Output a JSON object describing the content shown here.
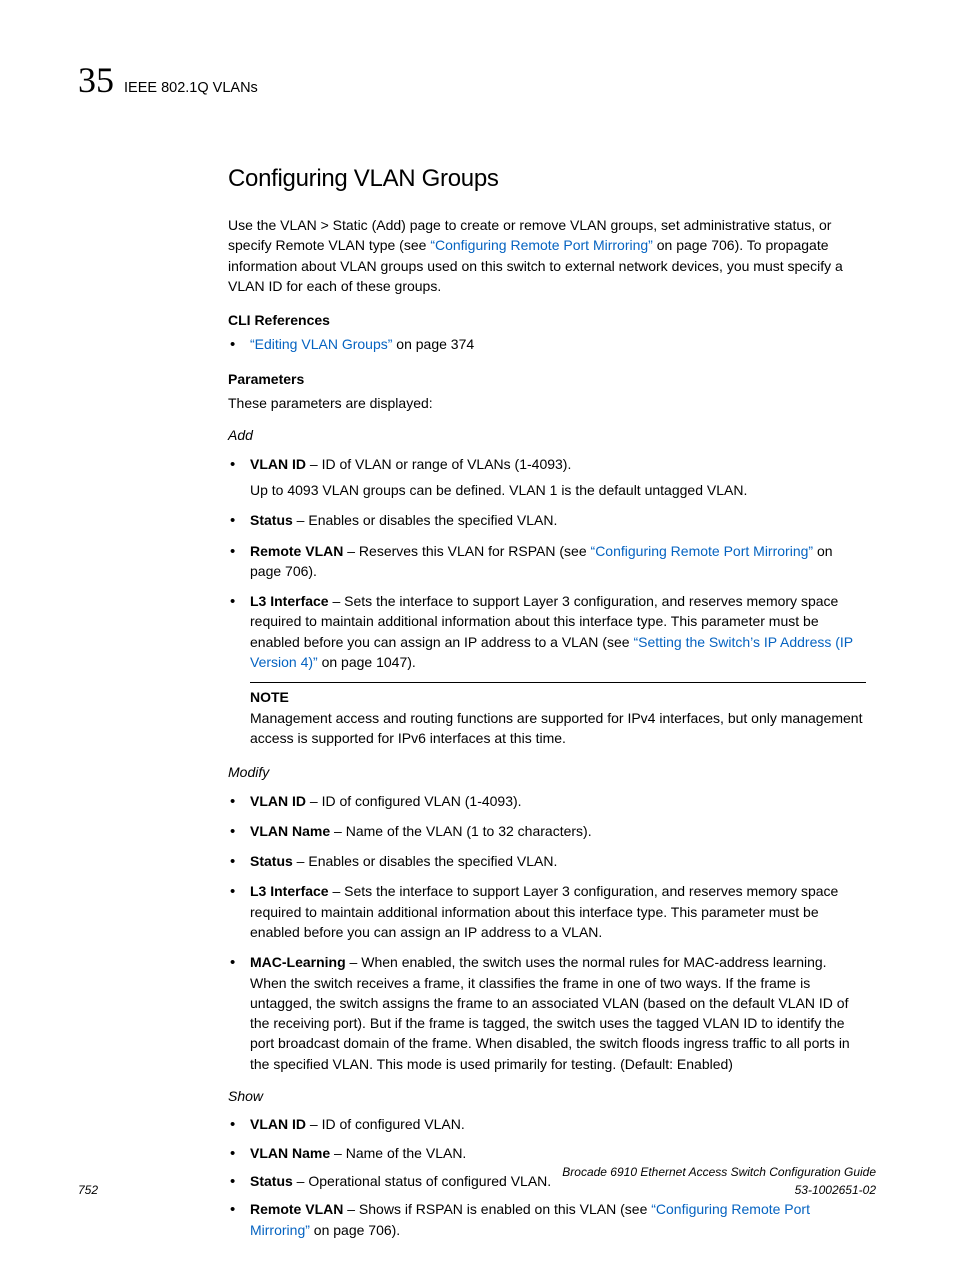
{
  "header": {
    "chapter_number": "35",
    "chapter_title": "IEEE 802.1Q VLANs"
  },
  "section": {
    "heading": "Configuring VLAN Groups",
    "intro_pre": "Use the VLAN > Static (Add) page to create or remove VLAN groups, set administrative status, or specify Remote VLAN type (see ",
    "intro_link1": "“Configuring Remote Port Mirroring”",
    "intro_post": " on page 706). To propagate information about VLAN groups used on this switch to external network devices, you must specify a VLAN ID for each of these groups.",
    "cli_heading": "CLI References",
    "cli_link": "“Editing VLAN Groups”",
    "cli_suffix": " on page 374",
    "params_heading": "Parameters",
    "params_intro": "These parameters are displayed:",
    "add_label": "Add",
    "add": {
      "vlan_id_term": "VLAN ID",
      "vlan_id_desc": " – ID of VLAN or range of VLANs (1-4093).",
      "vlan_id_sub": "Up to 4093 VLAN groups can be defined. VLAN 1 is the default untagged VLAN.",
      "status_term": "Status",
      "status_desc": " – Enables or disables the specified VLAN.",
      "remote_term": "Remote VLAN",
      "remote_pre": " – Reserves this VLAN for RSPAN (see ",
      "remote_link": "“Configuring Remote Port Mirroring”",
      "remote_post": " on page 706).",
      "l3_term": "L3 Interface",
      "l3_pre": " – Sets the interface to support Layer 3 configuration, and reserves memory space required to maintain additional information about this interface type. This parameter must be enabled before you can assign an IP address to a VLAN (see ",
      "l3_link": "“Setting the Switch’s IP Address (IP Version 4)”",
      "l3_post": " on page 1047)."
    },
    "note_label": "NOTE",
    "note_text": "Management access and routing functions are supported for IPv4 interfaces, but only management access is supported for IPv6 interfaces at this time.",
    "modify_label": "Modify",
    "modify": {
      "vlan_id_term": "VLAN ID",
      "vlan_id_desc": " – ID of configured VLAN (1-4093).",
      "vlan_name_term": "VLAN Name",
      "vlan_name_desc": " – Name of the VLAN (1 to 32 characters).",
      "status_term": "Status",
      "status_desc": " – Enables or disables the specified VLAN.",
      "l3_term": "L3 Interface",
      "l3_desc": " – Sets the interface to support Layer 3 configuration, and reserves memory space required to maintain additional information about this interface type. This parameter must be enabled before you can assign an IP address to a VLAN.",
      "mac_term": "MAC-Learning",
      "mac_desc": " – When enabled, the switch uses the normal rules for MAC-address learning. When the switch receives a frame, it classifies the frame in one of two ways. If the frame is untagged, the switch assigns the frame to an associated VLAN (based on the default VLAN ID of the receiving port). But if the frame is tagged, the switch uses the tagged VLAN ID to identify the port broadcast domain of the frame. When disabled, the switch floods ingress traffic to all ports in the specified VLAN. This mode is used primarily for testing. (Default: Enabled)"
    },
    "show_label": "Show",
    "show": {
      "vlan_id_term": "VLAN ID",
      "vlan_id_desc": " – ID of configured VLAN.",
      "vlan_name_term": "VLAN Name",
      "vlan_name_desc": " – Name of the VLAN.",
      "status_term": "Status",
      "status_desc": " – Operational status of configured VLAN.",
      "remote_term": "Remote VLAN",
      "remote_pre": " – Shows if RSPAN is enabled on this VLAN (see ",
      "remote_link": "“Configuring Remote Port Mirroring”",
      "remote_post": " on page 706)."
    }
  },
  "footer": {
    "page_number": "752",
    "title": "Brocade 6910 Ethernet Access Switch Configuration Guide",
    "docnum": "53-1002651-02"
  }
}
